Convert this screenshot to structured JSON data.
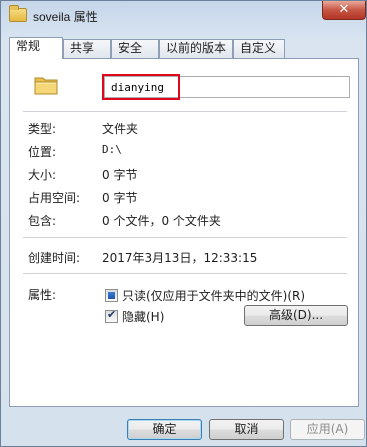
{
  "window": {
    "title": "soveila 属性",
    "close_glyph": "✕"
  },
  "tabs": [
    {
      "label": "常规",
      "active": true
    },
    {
      "label": "共享",
      "active": false
    },
    {
      "label": "安全",
      "active": false
    },
    {
      "label": "以前的版本",
      "active": false
    },
    {
      "label": "自定义",
      "active": false
    }
  ],
  "general": {
    "folder_icon": "folder-icon",
    "name_value": "dianying",
    "type": {
      "label": "类型:",
      "value": "文件夹"
    },
    "location": {
      "label": "位置:",
      "value": "D:\\"
    },
    "size": {
      "label": "大小:",
      "value": "0 字节"
    },
    "size_on_disk": {
      "label": "占用空间:",
      "value": "0 字节"
    },
    "contains": {
      "label": "包含:",
      "value": "0 个文件，0 个文件夹"
    },
    "created": {
      "label": "创建时间:",
      "value": "2017年3月13日，12:33:15"
    },
    "attributes": {
      "label": "属性:",
      "readonly_label": "只读(仅应用于文件夹中的文件)(R)",
      "hidden_label": "隐藏(H)",
      "advanced_label": "高级(D)..."
    }
  },
  "buttons": {
    "ok": "确定",
    "cancel": "取消",
    "apply": "应用(A)"
  },
  "colors": {
    "highlight": "#e0061b",
    "accent": "#3c7fb1"
  }
}
